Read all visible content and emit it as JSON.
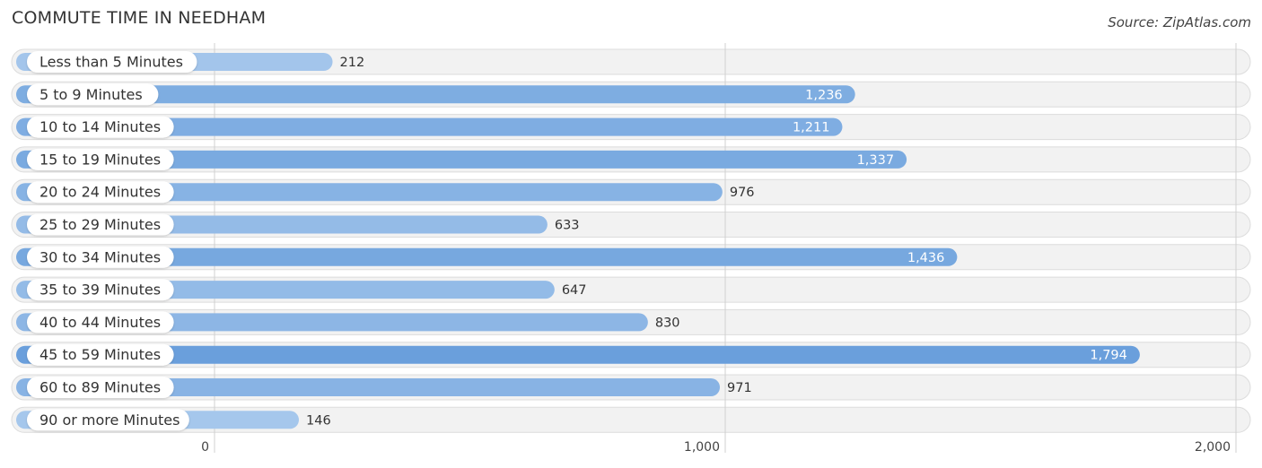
{
  "header": {
    "title": "COMMUTE TIME IN NEEDHAM",
    "source": "Source: ZipAtlas.com"
  },
  "chart_data": {
    "type": "bar",
    "orientation": "horizontal",
    "title": "COMMUTE TIME IN NEEDHAM",
    "source": "Source: ZipAtlas.com",
    "categories": [
      "Less than 5 Minutes",
      "5 to 9 Minutes",
      "10 to 14 Minutes",
      "15 to 19 Minutes",
      "20 to 24 Minutes",
      "25 to 29 Minutes",
      "30 to 34 Minutes",
      "35 to 39 Minutes",
      "40 to 44 Minutes",
      "45 to 59 Minutes",
      "60 to 89 Minutes",
      "90 or more Minutes"
    ],
    "values": [
      212,
      1236,
      1211,
      1337,
      976,
      633,
      1436,
      647,
      830,
      1794,
      971,
      146
    ],
    "value_labels": [
      "212",
      "1,236",
      "1,211",
      "1,337",
      "976",
      "633",
      "1,436",
      "647",
      "830",
      "1,794",
      "971",
      "146"
    ],
    "xlabel": "",
    "ylabel": "",
    "xlim": [
      0,
      2000
    ],
    "x_ticks": [
      0,
      1000,
      2000
    ],
    "x_tick_labels": [
      "0",
      "1,000",
      "2,000"
    ],
    "grid": true,
    "colors": {
      "bar_light": "#a7c8ec",
      "bar_dark": "#6a9fdc",
      "track": "#f2f2f2",
      "track_border": "#dcdcdc",
      "grid": "#d0d0d0"
    }
  }
}
